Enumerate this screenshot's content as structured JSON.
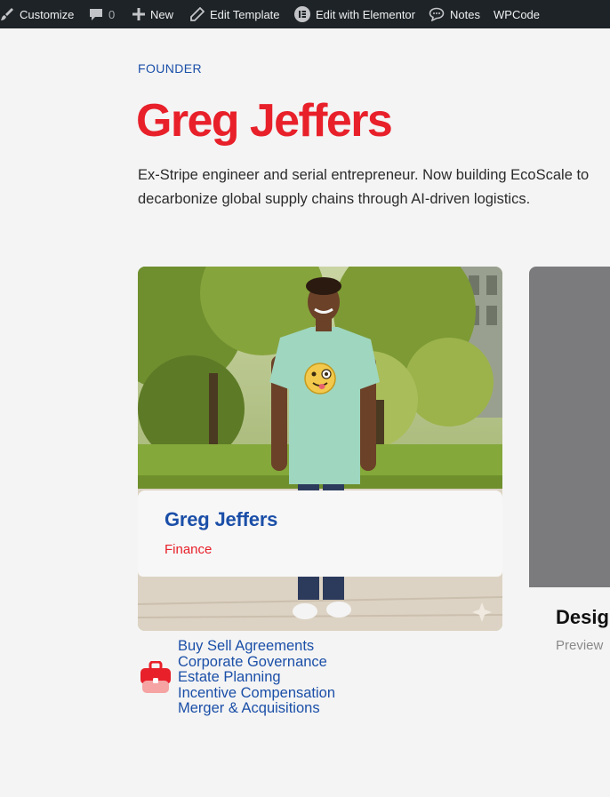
{
  "admin_bar": {
    "customize": "Customize",
    "comments_count": "0",
    "new": "New",
    "edit_template": "Edit Template",
    "edit_elementor": "Edit with Elementor",
    "notes": "Notes",
    "wpcode": "WPCode"
  },
  "hero": {
    "eyebrow": "FOUNDER",
    "name": "Greg Jeffers",
    "description": "Ex-Stripe engineer and serial entrepreneur. Now building EcoScale to decarbonize global supply chains through AI-driven logistics."
  },
  "card": {
    "name": "Greg Jeffers",
    "role": "Finance",
    "expertise": [
      "Buy Sell Agreements",
      "Corporate Governance",
      "Estate Planning",
      "Incentive Compensation",
      "Merger & Acquisitions"
    ]
  },
  "card2": {
    "title": "Desig",
    "subtitle": "Preview"
  },
  "colors": {
    "accent_red": "#e8202a",
    "accent_blue": "#1b4fa8",
    "admin_bar_bg": "#1d2327"
  }
}
